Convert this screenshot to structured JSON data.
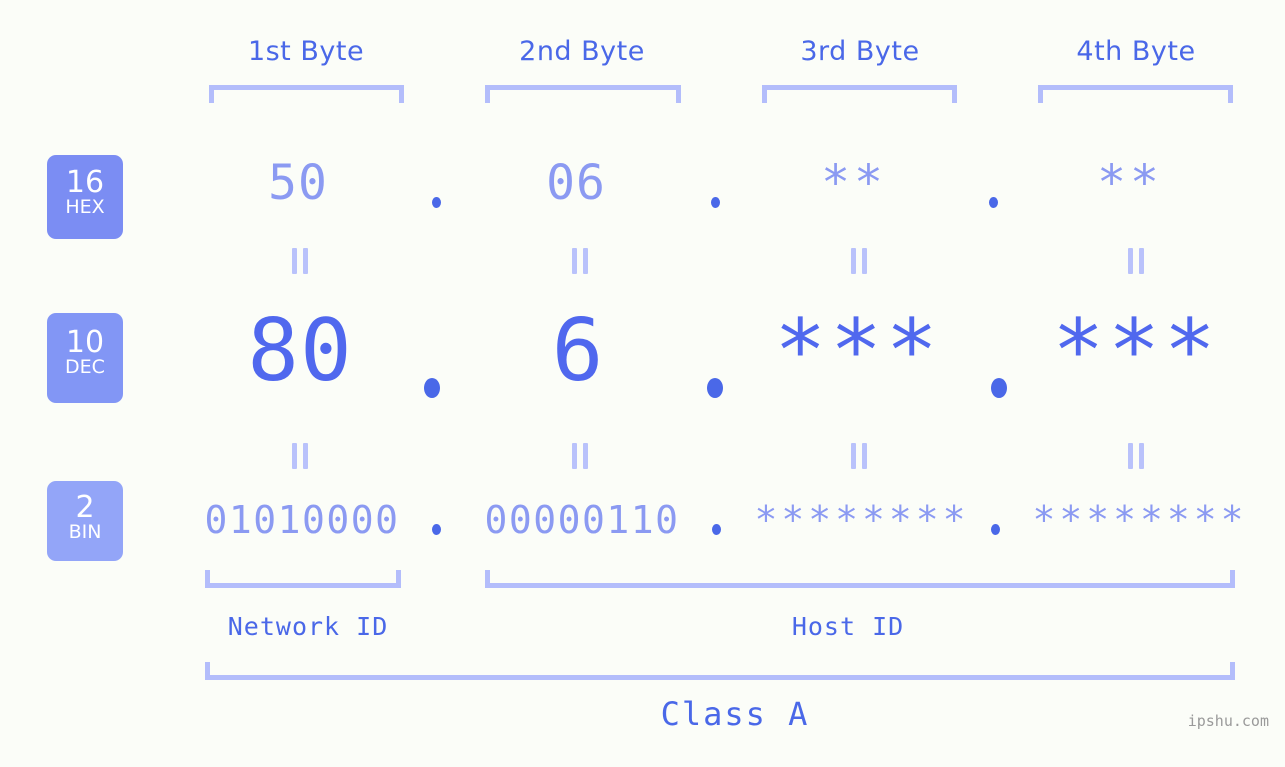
{
  "meta": {
    "background_color": "#fbfdf8",
    "accent_color": "#4a68e8",
    "light_accent_color": "#8b9af2",
    "bracket_color": "#b3bdfb",
    "watermark": "ipshu.com"
  },
  "byte_headers": [
    {
      "label": "1st Byte"
    },
    {
      "label": "2nd Byte"
    },
    {
      "label": "3rd Byte"
    },
    {
      "label": "4th Byte"
    }
  ],
  "bases": [
    {
      "number": "16",
      "name": "HEX",
      "color": "#7b8df3"
    },
    {
      "number": "10",
      "name": "DEC",
      "color": "#8296f5"
    },
    {
      "number": "2",
      "name": "BIN",
      "color": "#93a5f8"
    }
  ],
  "rows": {
    "hex": {
      "base": "16",
      "name": "HEX",
      "values": [
        "50",
        "06",
        "**",
        "**"
      ]
    },
    "dec": {
      "base": "10",
      "name": "DEC",
      "values": [
        "80",
        "6",
        "***",
        "***"
      ]
    },
    "bin": {
      "base": "2",
      "name": "BIN",
      "values": [
        "01010000",
        "00000110",
        "********",
        "********"
      ]
    }
  },
  "separators": {
    "dot": "."
  },
  "equality": {
    "symbol": "="
  },
  "sections": [
    {
      "label": "Network ID",
      "bytes": "1"
    },
    {
      "label": "Host ID",
      "bytes": "2-4"
    }
  ],
  "class": {
    "label": "Class A"
  }
}
